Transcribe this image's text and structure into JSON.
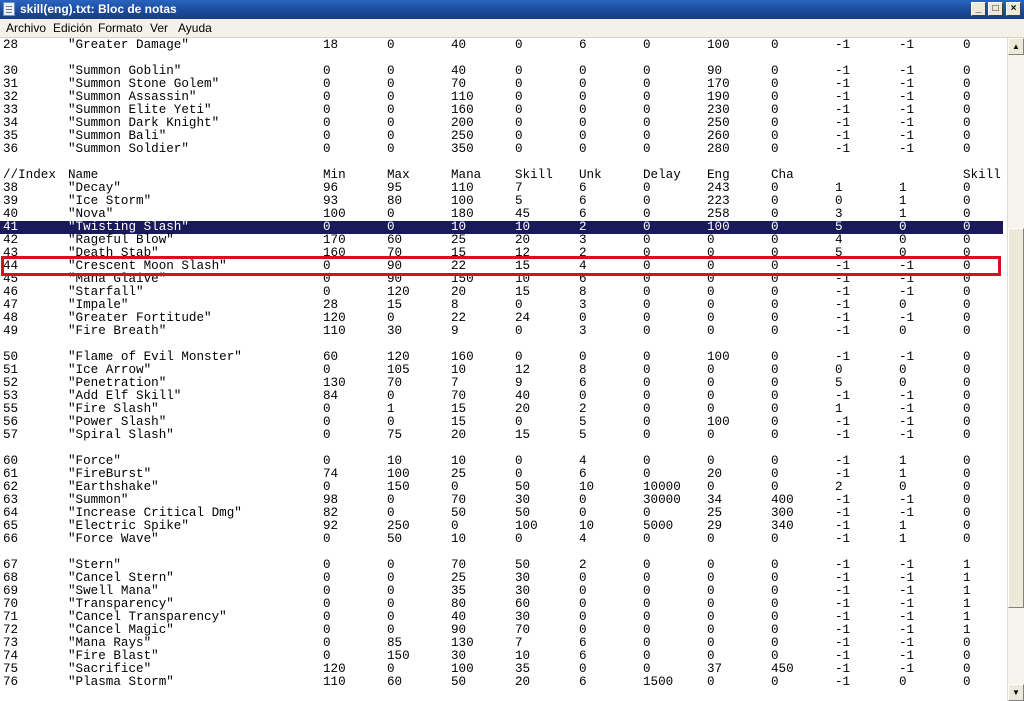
{
  "window": {
    "title": "skill(eng).txt: Bloc de notas",
    "icon": "notepad-icon",
    "buttons": {
      "minimize": "_",
      "maximize": "□",
      "close": "×"
    }
  },
  "menu": [
    "Archivo",
    "Edición",
    "Formato",
    "Ver",
    "Ayuda"
  ],
  "editor": {
    "selected_line_index": 14,
    "highlight_color": "#d41022",
    "selection_color": "#1a1a5a",
    "lines": [
      [
        "28",
        "\"Greater Damage\"",
        "18",
        "0",
        "40",
        "0",
        "6",
        "0",
        "100",
        "0",
        "-1",
        "-1",
        "0"
      ],
      [],
      [
        "30",
        "\"Summon Goblin\"",
        "0",
        "0",
        "40",
        "0",
        "0",
        "0",
        "90",
        "0",
        "-1",
        "-1",
        "0"
      ],
      [
        "31",
        "\"Summon Stone Golem\"",
        "0",
        "0",
        "70",
        "0",
        "0",
        "0",
        "170",
        "0",
        "-1",
        "-1",
        "0"
      ],
      [
        "32",
        "\"Summon Assassin\"",
        "0",
        "0",
        "110",
        "0",
        "0",
        "0",
        "190",
        "0",
        "-1",
        "-1",
        "0"
      ],
      [
        "33",
        "\"Summon Elite Yeti\"",
        "0",
        "0",
        "160",
        "0",
        "0",
        "0",
        "230",
        "0",
        "-1",
        "-1",
        "0"
      ],
      [
        "34",
        "\"Summon Dark Knight\"",
        "0",
        "0",
        "200",
        "0",
        "0",
        "0",
        "250",
        "0",
        "-1",
        "-1",
        "0"
      ],
      [
        "35",
        "\"Summon Bali\"",
        "0",
        "0",
        "250",
        "0",
        "0",
        "0",
        "260",
        "0",
        "-1",
        "-1",
        "0"
      ],
      [
        "36",
        "\"Summon Soldier\"",
        "0",
        "0",
        "350",
        "0",
        "0",
        "0",
        "280",
        "0",
        "-1",
        "-1",
        "0"
      ],
      [],
      [
        "//Index",
        "Name",
        "Min",
        "Max",
        "Mana",
        "Skill",
        "Unk",
        "Delay",
        "Eng",
        "Cha",
        "",
        "",
        "Skill"
      ],
      [
        "38",
        "\"Decay\"",
        "96",
        "95",
        "110",
        "7",
        "6",
        "0",
        "243",
        "0",
        "1",
        "1",
        "0"
      ],
      [
        "39",
        "\"Ice Storm\"",
        "93",
        "80",
        "100",
        "5",
        "6",
        "0",
        "223",
        "0",
        "0",
        "1",
        "0"
      ],
      [
        "40",
        "\"Nova\"",
        "100",
        "0",
        "180",
        "45",
        "6",
        "0",
        "258",
        "0",
        "3",
        "1",
        "0"
      ],
      [
        "41",
        "\"Twisting Slash\"",
        "0",
        "0",
        "10",
        "10",
        "2",
        "0",
        "100",
        "0",
        "5",
        "0",
        "0"
      ],
      [
        "42",
        "\"Rageful Blow\"",
        "170",
        "60",
        "25",
        "20",
        "3",
        "0",
        "0",
        "0",
        "4",
        "0",
        "0"
      ],
      [
        "43",
        "\"Death Stab\"",
        "160",
        "70",
        "15",
        "12",
        "2",
        "0",
        "0",
        "0",
        "5",
        "0",
        "0"
      ],
      [
        "44",
        "\"Crescent Moon Slash\"",
        "0",
        "90",
        "22",
        "15",
        "4",
        "0",
        "0",
        "0",
        "-1",
        "-1",
        "0"
      ],
      [
        "45",
        "\"Mana Glaive\"",
        "0",
        "90",
        "150",
        "10",
        "6",
        "0",
        "0",
        "0",
        "-1",
        "-1",
        "0"
      ],
      [
        "46",
        "\"Starfall\"",
        "0",
        "120",
        "20",
        "15",
        "8",
        "0",
        "0",
        "0",
        "-1",
        "-1",
        "0"
      ],
      [
        "47",
        "\"Impale\"",
        "28",
        "15",
        "8",
        "0",
        "3",
        "0",
        "0",
        "0",
        "-1",
        "0",
        "0"
      ],
      [
        "48",
        "\"Greater Fortitude\"",
        "120",
        "0",
        "22",
        "24",
        "0",
        "0",
        "0",
        "0",
        "-1",
        "-1",
        "0"
      ],
      [
        "49",
        "\"Fire Breath\"",
        "110",
        "30",
        "9",
        "0",
        "3",
        "0",
        "0",
        "0",
        "-1",
        "0",
        "0"
      ],
      [],
      [
        "50",
        "\"Flame of Evil Monster\"",
        "60",
        "120",
        "160",
        "0",
        "0",
        "0",
        "100",
        "0",
        "-1",
        "-1",
        "0"
      ],
      [
        "51",
        "\"Ice Arrow\"",
        "0",
        "105",
        "10",
        "12",
        "8",
        "0",
        "0",
        "0",
        "0",
        "0",
        "0"
      ],
      [
        "52",
        "\"Penetration\"",
        "130",
        "70",
        "7",
        "9",
        "6",
        "0",
        "0",
        "0",
        "5",
        "0",
        "0"
      ],
      [
        "53",
        "\"Add Elf Skill\"",
        "84",
        "0",
        "70",
        "40",
        "0",
        "0",
        "0",
        "0",
        "-1",
        "-1",
        "0"
      ],
      [
        "55",
        "\"Fire Slash\"",
        "0",
        "1",
        "15",
        "20",
        "2",
        "0",
        "0",
        "0",
        "1",
        "-1",
        "0"
      ],
      [
        "56",
        "\"Power Slash\"",
        "0",
        "0",
        "15",
        "0",
        "5",
        "0",
        "100",
        "0",
        "-1",
        "-1",
        "0"
      ],
      [
        "57",
        "\"Spiral Slash\"",
        "0",
        "75",
        "20",
        "15",
        "5",
        "0",
        "0",
        "0",
        "-1",
        "-1",
        "0"
      ],
      [],
      [
        "60",
        "\"Force\"",
        "0",
        "10",
        "10",
        "0",
        "4",
        "0",
        "0",
        "0",
        "-1",
        "1",
        "0"
      ],
      [
        "61",
        "\"FireBurst\"",
        "74",
        "100",
        "25",
        "0",
        "6",
        "0",
        "20",
        "0",
        "-1",
        "1",
        "0"
      ],
      [
        "62",
        "\"Earthshake\"",
        "0",
        "150",
        "0",
        "50",
        "10",
        "10000",
        "0",
        "0",
        "2",
        "0",
        "0"
      ],
      [
        "63",
        "\"Summon\"",
        "98",
        "0",
        "70",
        "30",
        "0",
        "30000",
        "34",
        "400",
        "-1",
        "-1",
        "0"
      ],
      [
        "64",
        "\"Increase Critical Dmg\"",
        "82",
        "0",
        "50",
        "50",
        "0",
        "0",
        "25",
        "300",
        "-1",
        "-1",
        "0"
      ],
      [
        "65",
        "\"Electric Spike\"",
        "92",
        "250",
        "0",
        "100",
        "10",
        "5000",
        "29",
        "340",
        "-1",
        "1",
        "0"
      ],
      [
        "66",
        "\"Force Wave\"",
        "0",
        "50",
        "10",
        "0",
        "4",
        "0",
        "0",
        "0",
        "-1",
        "1",
        "0"
      ],
      [],
      [
        "67",
        "\"Stern\"",
        "0",
        "0",
        "70",
        "50",
        "2",
        "0",
        "0",
        "0",
        "-1",
        "-1",
        "1"
      ],
      [
        "68",
        "\"Cancel Stern\"",
        "0",
        "0",
        "25",
        "30",
        "0",
        "0",
        "0",
        "0",
        "-1",
        "-1",
        "1"
      ],
      [
        "69",
        "\"Swell Mana\"",
        "0",
        "0",
        "35",
        "30",
        "0",
        "0",
        "0",
        "0",
        "-1",
        "-1",
        "1"
      ],
      [
        "70",
        "\"Transparency\"",
        "0",
        "0",
        "80",
        "60",
        "0",
        "0",
        "0",
        "0",
        "-1",
        "-1",
        "1"
      ],
      [
        "71",
        "\"Cancel Transparency\"",
        "0",
        "0",
        "40",
        "30",
        "0",
        "0",
        "0",
        "0",
        "-1",
        "-1",
        "1"
      ],
      [
        "72",
        "\"Cancel Magic\"",
        "0",
        "0",
        "90",
        "70",
        "0",
        "0",
        "0",
        "0",
        "-1",
        "-1",
        "1"
      ],
      [
        "73",
        "\"Mana Rays\"",
        "0",
        "85",
        "130",
        "7",
        "6",
        "0",
        "0",
        "0",
        "-1",
        "-1",
        "0"
      ],
      [
        "74",
        "\"Fire Blast\"",
        "0",
        "150",
        "30",
        "10",
        "6",
        "0",
        "0",
        "0",
        "-1",
        "-1",
        "0"
      ],
      [
        "75",
        "\"Sacrifice\"",
        "120",
        "0",
        "100",
        "35",
        "0",
        "0",
        "37",
        "450",
        "-1",
        "-1",
        "0"
      ],
      [
        "76",
        "\"Plasma Storm\"",
        "110",
        "60",
        "50",
        "20",
        "6",
        "1500",
        "0",
        "0",
        "-1",
        "0",
        "0"
      ]
    ]
  }
}
